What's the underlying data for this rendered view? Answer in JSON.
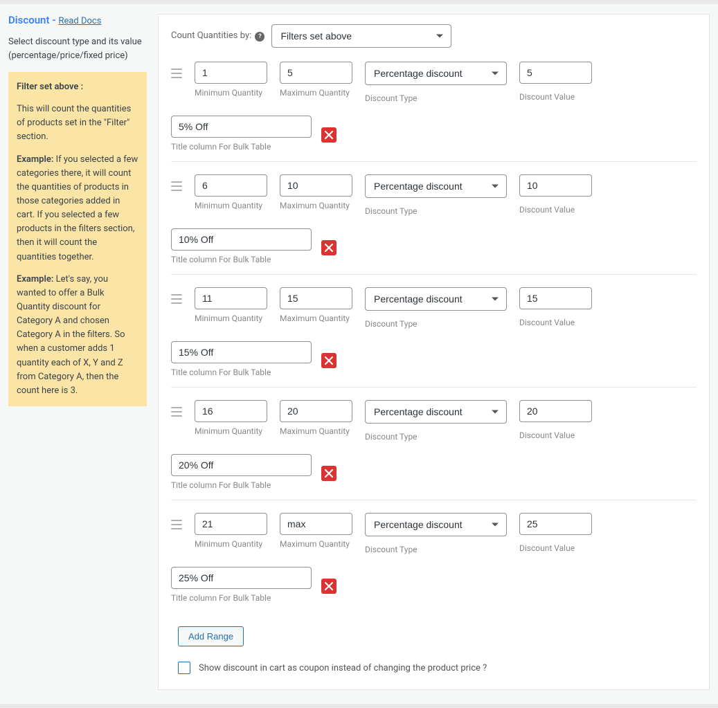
{
  "sidebar": {
    "title": "Discount",
    "dash": " - ",
    "docs_link": "Read Docs",
    "description": "Select discount type and its value (percentage/price/fixed price)",
    "info": {
      "heading": "Filter set above :",
      "p1": "This will count the quantities of products set in the \"Filter\" section.",
      "ex_label1": "Example:",
      "p2": " If you selected a few categories there, it will count the quantities of products in those categories added in cart. If you selected a few products in the filters section, then it will count the quantities together.",
      "ex_label2": "Example:",
      "p3": " Let's say, you wanted to offer a Bulk Quantity discount for Category A and chosen Category A in the filters. So when a customer adds 1 quantity each of X, Y and Z from Category A, then the count here is 3."
    }
  },
  "count": {
    "label": "Count Quantities by:",
    "value": "Filters set above"
  },
  "labels": {
    "min": "Minimum Quantity",
    "max": "Maximum Quantity",
    "type": "Discount Type",
    "value": "Discount Value",
    "title": "Title column For Bulk Table"
  },
  "discount_type": "Percentage discount",
  "ranges": [
    {
      "min": "1",
      "max": "5",
      "value": "5",
      "title": "5% Off"
    },
    {
      "min": "6",
      "max": "10",
      "value": "10",
      "title": "10% Off"
    },
    {
      "min": "11",
      "max": "15",
      "value": "15",
      "title": "15% Off"
    },
    {
      "min": "16",
      "max": "20",
      "value": "20",
      "title": "20% Off"
    },
    {
      "min": "21",
      "max": "max",
      "value": "25",
      "title": "25% Off"
    }
  ],
  "add_range": "Add Range",
  "coupon_checkbox": "Show discount in cart as coupon instead of changing the product price ?"
}
